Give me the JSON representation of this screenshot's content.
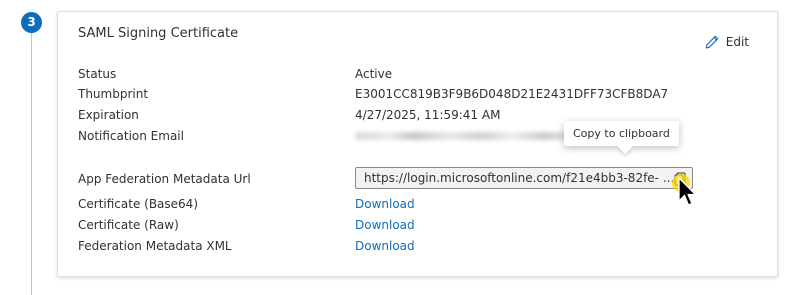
{
  "step": {
    "number": "3"
  },
  "card": {
    "title": "SAML Signing Certificate",
    "edit_label": "Edit"
  },
  "fields": {
    "status": {
      "label": "Status",
      "value": "Active"
    },
    "thumbprint": {
      "label": "Thumbprint",
      "value": "E3001CC819B3F9B6D048D21E2431DFF73CFB8DA7"
    },
    "expiration": {
      "label": "Expiration",
      "value": "4/27/2025, 11:59:41 AM"
    },
    "notification_email": {
      "label": "Notification Email"
    },
    "metadata_url": {
      "label": "App Federation Metadata Url",
      "value": "https://login.microsoftonline.com/f21e4bb3-82fe- ..."
    },
    "cert_base64": {
      "label": "Certificate (Base64)",
      "link": "Download"
    },
    "cert_raw": {
      "label": "Certificate (Raw)",
      "link": "Download"
    },
    "federation_xml": {
      "label": "Federation Metadata XML",
      "link": "Download"
    }
  },
  "tooltip": {
    "text": "Copy to clipboard"
  },
  "colors": {
    "accent": "#0f6cbd",
    "link": "#0f6cbd",
    "cursor_fill": "#ffd800"
  },
  "icons": {
    "edit": "pencil-icon",
    "copy": "copy-icon",
    "cursor": "mouse-pointer-icon"
  }
}
